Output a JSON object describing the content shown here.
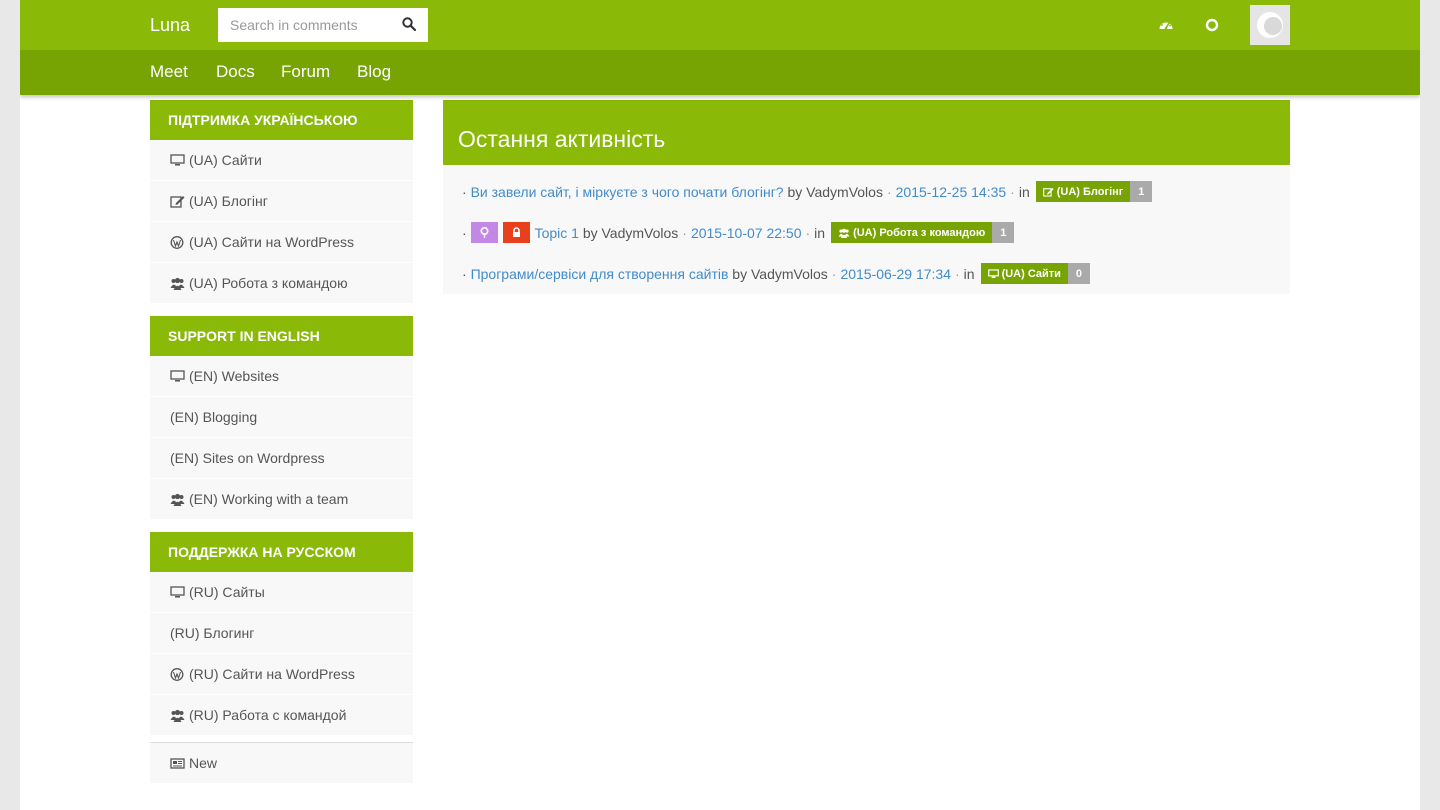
{
  "brand": "Luna",
  "search": {
    "placeholder": "Search in comments"
  },
  "nav": [
    "Meet",
    "Docs",
    "Forum",
    "Blog"
  ],
  "top_icons": [
    "dashboard-icon",
    "circle-o-icon"
  ],
  "sidebar": {
    "sections": [
      {
        "title": "Підтримка українською",
        "items": [
          {
            "label": "(UA) Сайти",
            "icon": "desktop-icon"
          },
          {
            "label": "(UA) Блогінг",
            "icon": "edit-icon"
          },
          {
            "label": "(UA) Сайти на WordPress",
            "icon": "wordpress-icon"
          },
          {
            "label": "(UA) Робота з командою",
            "icon": "users-icon"
          }
        ]
      },
      {
        "title": "Support in English",
        "items": [
          {
            "label": "(EN) Websites",
            "icon": "desktop-icon"
          },
          {
            "label": "(EN) Blogging",
            "icon": ""
          },
          {
            "label": "(EN) Sites on Wordpress",
            "icon": ""
          },
          {
            "label": "(EN) Working with a team",
            "icon": "users-icon"
          }
        ]
      },
      {
        "title": "Поддержка на русском",
        "items": [
          {
            "label": "(RU) Сайты",
            "icon": "desktop-icon"
          },
          {
            "label": "(RU) Блогинг",
            "icon": ""
          },
          {
            "label": "(RU) Сайти на WordPress",
            "icon": "wordpress-icon"
          },
          {
            "label": "(RU) Работа с командой",
            "icon": "users-icon"
          }
        ]
      }
    ],
    "extra": {
      "label": "New",
      "icon": "newspaper-icon"
    }
  },
  "main": {
    "title": "Остання активність",
    "activity": [
      {
        "topic": "Ви завели сайт, і міркуєте з чого почати блогінг?",
        "by": "by",
        "author": "VadymVolos",
        "date": "2015-12-25 14:35",
        "in": "in",
        "forum": "(UA) Блогінг",
        "forum_icon": "edit-icon",
        "count": "1",
        "tags": []
      },
      {
        "topic": "Topic 1",
        "by": "by",
        "author": "VadymVolos",
        "date": "2015-10-07 22:50",
        "in": "in",
        "forum": "(UA) Робота з командою",
        "forum_icon": "users-icon",
        "count": "1",
        "tags": [
          "pin-icon",
          "lock-icon"
        ]
      },
      {
        "topic": "Програми/сервіси для створення сайтів",
        "by": "by",
        "author": "VadymVolos",
        "date": "2015-06-29 17:34",
        "in": "in",
        "forum": "(UA) Сайти",
        "forum_icon": "desktop-icon",
        "count": "0",
        "tags": []
      }
    ]
  },
  "colors": {
    "green": "#8ab907",
    "dark_green": "#78a403",
    "link": "#428bca",
    "pin": "#c387e6",
    "lock": "#e8401c"
  }
}
